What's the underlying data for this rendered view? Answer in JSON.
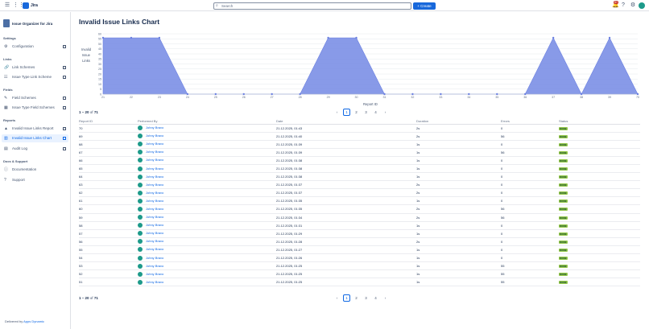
{
  "topbar": {
    "app_name": "Jira",
    "search_placeholder": "Search",
    "create_label": "+ Create",
    "notifications_count": "9+"
  },
  "sidebar": {
    "app_title": "Issue Organizer for Jira",
    "sections": {
      "settings": "Settings",
      "links": "Links",
      "fields": "Fields",
      "reports": "Reports",
      "docs": "Docs & Support"
    },
    "items": {
      "configuration": "Configuration",
      "link_schemes": "Link Schemes",
      "issue_type_link_scheme": "Issue Type Link Scheme",
      "field_schemes": "Field Schemes",
      "issue_type_field_schemes": "Issue Type Field Schemes",
      "invalid_issue_links_report": "Invalid Issue Links Report",
      "invalid_issue_links_chart": "Invalid Issue Links Chart",
      "audit_log": "Audit Log",
      "documentation": "Documentation",
      "support": "Support"
    },
    "delivered_by_prefix": "Delivered by",
    "delivered_by_link": "Apps Dynamic"
  },
  "page": {
    "title": "Invalid Issue Links Chart"
  },
  "chart_data": {
    "type": "area",
    "title": "",
    "xlabel": "Report ID",
    "ylabel": "Invalid Issue Links",
    "x": [
      "21",
      "22",
      "23",
      "24",
      "25",
      "26",
      "27",
      "28",
      "29",
      "30",
      "31",
      "32",
      "33",
      "34",
      "35",
      "36",
      "37",
      "38",
      "39",
      "70"
    ],
    "values": [
      56,
      56,
      56,
      0,
      0,
      0,
      0,
      0,
      56,
      56,
      0,
      0,
      0,
      0,
      0,
      0,
      56,
      0,
      56,
      0
    ],
    "ylim": [
      0,
      60
    ],
    "yticks": [
      0,
      5,
      10,
      15,
      20,
      25,
      30,
      35,
      40,
      45,
      50,
      55,
      60
    ],
    "color": "#7b8fe6",
    "grid": true
  },
  "pagination": {
    "range_text": "1 – 20",
    "of_text": "of",
    "total": "71",
    "pages": [
      "1",
      "2",
      "3",
      "4"
    ],
    "current_page": "1",
    "prev": "‹",
    "next": "›"
  },
  "table": {
    "columns": [
      "Report ID",
      "Performed By",
      "Date",
      "Duration",
      "Errors",
      "Status"
    ],
    "rows": [
      {
        "id": "70",
        "user": "Johny Bravo",
        "date": "21.12.2025, 01:43",
        "duration": "2s",
        "errors": "0",
        "status": "DONE"
      },
      {
        "id": "69",
        "user": "Johny Bravo",
        "date": "21.12.2025, 01:40",
        "duration": "2s",
        "errors": "56",
        "status": "DONE"
      },
      {
        "id": "68",
        "user": "Johny Bravo",
        "date": "21.12.2025, 01:39",
        "duration": "1s",
        "errors": "0",
        "status": "DONE"
      },
      {
        "id": "67",
        "user": "Johny Bravo",
        "date": "21.12.2025, 01:39",
        "duration": "1s",
        "errors": "56",
        "status": "DONE"
      },
      {
        "id": "66",
        "user": "Johny Bravo",
        "date": "21.12.2025, 01:38",
        "duration": "1s",
        "errors": "0",
        "status": "DONE"
      },
      {
        "id": "65",
        "user": "Johny Bravo",
        "date": "21.12.2025, 01:38",
        "duration": "1s",
        "errors": "0",
        "status": "DONE"
      },
      {
        "id": "64",
        "user": "Johny Bravo",
        "date": "21.12.2025, 01:38",
        "duration": "1s",
        "errors": "0",
        "status": "DONE"
      },
      {
        "id": "63",
        "user": "Johny Bravo",
        "date": "21.12.2025, 01:37",
        "duration": "2s",
        "errors": "0",
        "status": "DONE"
      },
      {
        "id": "62",
        "user": "Johny Bravo",
        "date": "21.12.2025, 01:37",
        "duration": "2s",
        "errors": "0",
        "status": "DONE"
      },
      {
        "id": "61",
        "user": "Johny Bravo",
        "date": "21.12.2025, 01:35",
        "duration": "1s",
        "errors": "0",
        "status": "DONE"
      },
      {
        "id": "60",
        "user": "Johny Bravo",
        "date": "21.12.2025, 01:35",
        "duration": "2s",
        "errors": "56",
        "status": "DONE"
      },
      {
        "id": "59",
        "user": "Johny Bravo",
        "date": "21.12.2025, 01:34",
        "duration": "2s",
        "errors": "56",
        "status": "DONE"
      },
      {
        "id": "58",
        "user": "Johny Bravo",
        "date": "21.12.2025, 01:31",
        "duration": "1s",
        "errors": "0",
        "status": "DONE"
      },
      {
        "id": "57",
        "user": "Johny Bravo",
        "date": "21.12.2025, 01:29",
        "duration": "1s",
        "errors": "0",
        "status": "DONE"
      },
      {
        "id": "56",
        "user": "Johny Bravo",
        "date": "21.12.2025, 01:28",
        "duration": "2s",
        "errors": "0",
        "status": "DONE"
      },
      {
        "id": "55",
        "user": "Johny Bravo",
        "date": "21.12.2025, 01:27",
        "duration": "1s",
        "errors": "0",
        "status": "DONE"
      },
      {
        "id": "54",
        "user": "Johny Bravo",
        "date": "21.12.2025, 01:26",
        "duration": "1s",
        "errors": "0",
        "status": "DONE"
      },
      {
        "id": "53",
        "user": "Johny Bravo",
        "date": "21.12.2025, 01:25",
        "duration": "1s",
        "errors": "55",
        "status": "DONE"
      },
      {
        "id": "52",
        "user": "Johny Bravo",
        "date": "21.12.2025, 01:25",
        "duration": "1s",
        "errors": "55",
        "status": "DONE"
      },
      {
        "id": "51",
        "user": "Johny Bravo",
        "date": "21.12.2025, 01:25",
        "duration": "1s",
        "errors": "55",
        "status": "DONE"
      }
    ]
  }
}
